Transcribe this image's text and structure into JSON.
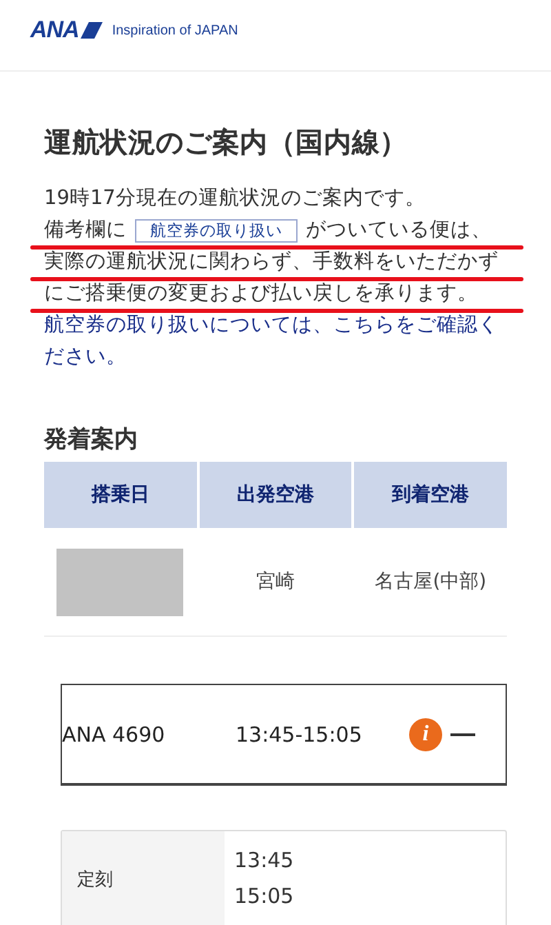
{
  "header": {
    "brand": "ANA",
    "tagline": "Inspiration of JAPAN"
  },
  "title": "運航状況のご案内（国内線）",
  "notice": {
    "status_line": "19時17分現在の運航状況のご案内です。",
    "before_tag": "備考欄に",
    "tag": "航空券の取り扱い",
    "after_tag": "がついている便は、",
    "more_lines": [
      "実際の運航状況に関わらず、手数料をいただかず",
      "にご搭乗便の変更および払い戻しを承ります。"
    ],
    "underlined": true,
    "link": "航空券の取り扱いについては、こちらをご確認ください。"
  },
  "section_title": "発着案内",
  "table": {
    "columns": [
      "搭乗日",
      "出発空港",
      "到着空港"
    ],
    "rows": [
      {
        "date_redacted": true,
        "departure": "宮崎",
        "arrival": "名古屋(中部)"
      }
    ]
  },
  "flight": {
    "number": "ANA 4690",
    "times": "13:45-15:05",
    "info_icon": "i",
    "expanded": true
  },
  "details": [
    {
      "label": "定刻",
      "values": [
        "13:45",
        "15:05"
      ]
    }
  ]
}
